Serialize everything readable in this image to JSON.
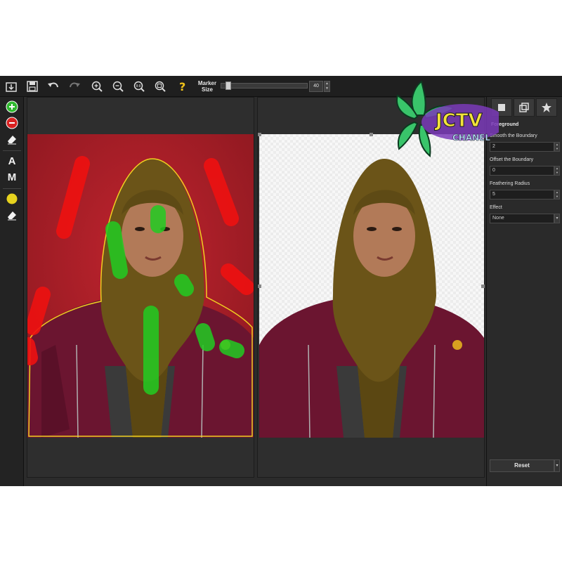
{
  "toolbar": {
    "tools": [
      "open-icon",
      "save-icon",
      "undo-icon",
      "redo-icon",
      "zoom-in-icon",
      "zoom-out-icon",
      "zoom-actual-icon",
      "zoom-fit-icon",
      "help-icon"
    ],
    "marker_size_label": "Marker Size",
    "marker_size_value": "40",
    "marker_size_fraction": 0.05
  },
  "leftbar": {
    "tools": [
      "add-foreground-marker-icon",
      "add-background-marker-icon",
      "eraser-icon"
    ],
    "auto_label": "A",
    "manual_label": "M",
    "edge_tools": [
      "edge-marker-icon",
      "edge-eraser-icon"
    ]
  },
  "panel": {
    "tabs": [
      "foreground-tab-icon",
      "background-tab-icon",
      "effects-tab-icon"
    ],
    "title": "Foreground",
    "smooth_label": "Smooth the Boundary",
    "smooth_value": "2",
    "offset_label": "Offset the Boundary",
    "offset_value": "0",
    "feather_label": "Feathering Radius",
    "feather_value": "5",
    "effect_label": "Effect",
    "effect_value": "None",
    "reset_label": "Reset"
  },
  "watermark": {
    "line1": "JCTV",
    "line2": "CHANEL"
  },
  "colors": {
    "app_background": "#2b2b2b",
    "foreground_marker": "#22cc22",
    "background_marker": "#ee1111",
    "boundary": "#f0d020",
    "photo_background": "#b0202a"
  }
}
